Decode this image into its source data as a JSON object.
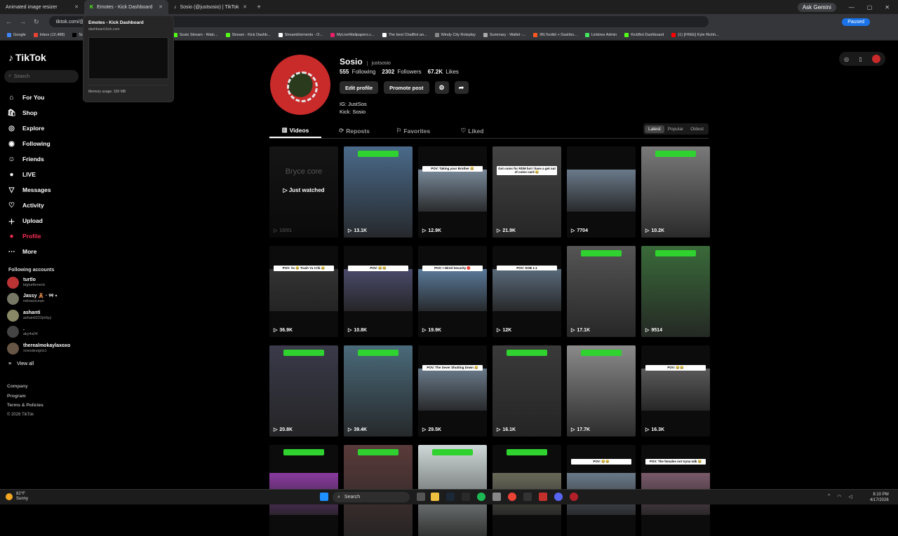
{
  "browser": {
    "tabs": [
      {
        "title": "Animated image resizer"
      },
      {
        "title": "Emotes - Kick Dashboard"
      },
      {
        "title": "Sosio (@justsosio) | TikTok"
      }
    ],
    "new_tab": "+",
    "ask_gemini": "Ask Gemini",
    "url": "tiktok.com/@",
    "paused": "Paused",
    "bookmarks": [
      "Google",
      "Inbox (12,488)",
      "Sosio (@justsosio) | Ti...",
      "(1) Sosaa - Twitch",
      "Sosio Stream - Watc...",
      "Stream - Kick Dashb...",
      "StreamElements - O...",
      "MyLiveWallpapers.c...",
      "The best ChatBot an...",
      "Windy City Roleplay",
      "Summary - Wallet -...",
      "IRLToolkit + Dashbo...",
      "Linktree Admin",
      "KickBot Dashboard",
      "(1) [FREE] Kyle Richh..."
    ],
    "tab_hover": {
      "title": "Emotes - Kick Dashboard",
      "domain": "dashboard.kick.com",
      "memory": "Memory usage: 339 MB"
    }
  },
  "tiktok": {
    "logo": "TikTok",
    "search_placeholder": "Search",
    "menu": [
      "For You",
      "Shop",
      "Explore",
      "Following",
      "Friends",
      "LIVE",
      "Messages",
      "Activity",
      "Upload",
      "Profile",
      "More"
    ],
    "following_title": "Following accounts",
    "accounts": [
      {
        "name": "turtlo",
        "handle": "bigturtleneck"
      },
      {
        "name": "Jassy 🧸 · ୨୧ ⋆",
        "handle": "nelrasocean"
      },
      {
        "name": "ashanti",
        "handle": "ashanti222prttyy"
      },
      {
        "name": ".",
        "handle": "aky4a04"
      },
      {
        "name": "therealmokaylaxoxo",
        "handle": "xoxodesigns1"
      }
    ],
    "view_all": "View all",
    "footer": [
      "Company",
      "Program",
      "Terms & Policies",
      "© 2026 TikTok"
    ]
  },
  "profile": {
    "display_name": "Sosio",
    "username": "justsosio",
    "following": "555",
    "following_label": "Following",
    "followers": "2302",
    "followers_label": "Followers",
    "likes": "67.2K",
    "likes_label": "Likes",
    "edit_profile": "Edit profile",
    "promote_post": "Promote post",
    "bio_line1": "IG: JustSos",
    "bio_line2": "Kick: Sosio",
    "tabs": [
      "Videos",
      "Reposts",
      "Favorites",
      "Liked"
    ],
    "sort": [
      "Latest",
      "Popular",
      "Oldest"
    ]
  },
  "videos": [
    {
      "views": "15/01",
      "overlay": "Just watched",
      "ghost": "Bryce core"
    },
    {
      "views": "13.1K"
    },
    {
      "views": "12.9K",
      "caption": "POV: Taking your Brother 😂"
    },
    {
      "views": "21.9K",
      "caption": "Got coms for RDM but I have a get out of coms card 😂"
    },
    {
      "views": "7704"
    },
    {
      "views": "10.2K"
    },
    {
      "views": "36.9K",
      "caption": "POV: Ya 😂 Trash Ya Crib 😂"
    },
    {
      "views": "10.8K",
      "caption": "POV: 😂😂"
    },
    {
      "views": "19.9K",
      "caption": "POV: I Hired Security 🛑"
    },
    {
      "views": "12K",
      "caption": "POV: SOB 1:1"
    },
    {
      "views": "17.1K"
    },
    {
      "views": "9514"
    },
    {
      "views": "20.8K"
    },
    {
      "views": "39.4K"
    },
    {
      "views": "29.5K",
      "caption": "POV: The Sever Shutting Down 😂"
    },
    {
      "views": "16.1K"
    },
    {
      "views": "17.7K"
    },
    {
      "views": "16.3K",
      "caption": "POV: 😂😂"
    },
    {
      "views": ""
    },
    {
      "views": ""
    },
    {
      "views": ""
    },
    {
      "views": ""
    },
    {
      "views": "",
      "caption": "POV: 😂😂"
    },
    {
      "views": "",
      "caption": "POV: The females not tryna talk 😂"
    }
  ],
  "taskbar": {
    "temp": "82°F",
    "condition": "Sunny",
    "search": "Search",
    "time": "8:10 PM",
    "date": "4/17/2026"
  }
}
